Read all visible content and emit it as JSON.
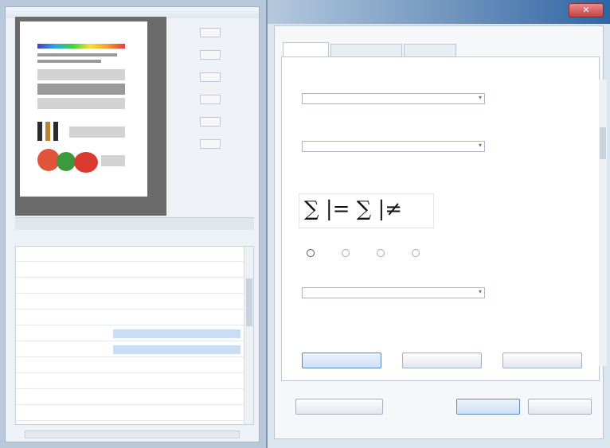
{
  "left_panel": {
    "zoom_ticks": [
      "",
      "",
      "",
      "",
      "",
      ""
    ],
    "properties": [
      {
        "name": "",
        "value": ""
      },
      {
        "name": "",
        "value": ""
      },
      {
        "name": "",
        "value": ""
      },
      {
        "name": "",
        "value": ""
      },
      {
        "name": "",
        "value": ""
      },
      {
        "name": "",
        "value": ""
      },
      {
        "name": "",
        "value": ""
      },
      {
        "name": "",
        "value": ""
      },
      {
        "name": "",
        "value": ""
      },
      {
        "name": "",
        "value": ""
      },
      {
        "name": "",
        "value": ""
      }
    ]
  },
  "dialog": {
    "close_glyph": "✕",
    "tabs": [
      "",
      "",
      ""
    ],
    "field1": {
      "label": "",
      "value": ""
    },
    "field2": {
      "label": "",
      "value": ""
    },
    "glyph_label": "",
    "glyphs": "∑ |= ∑ |≠",
    "field3": {
      "label": "",
      "value": ""
    },
    "mid_buttons": [
      "",
      "",
      ""
    ],
    "bottom_buttons": {
      "left": "",
      "ok": "",
      "cancel": ""
    }
  },
  "colors": {
    "title_gradient_end": "#2f65a5",
    "close": "#c84141",
    "selection": "#c9def5"
  }
}
